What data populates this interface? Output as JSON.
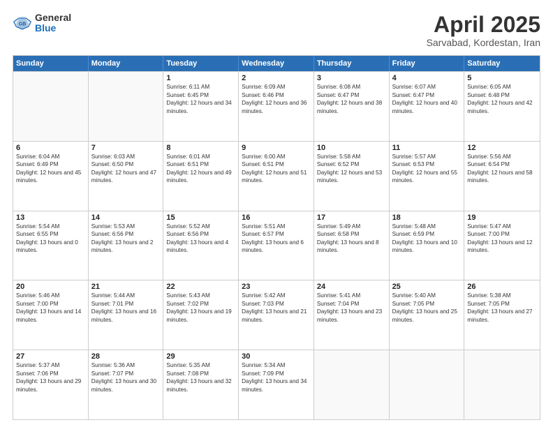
{
  "header": {
    "logo": {
      "general": "General",
      "blue": "Blue"
    },
    "title": "April 2025",
    "location": "Sarvabad, Kordestan, Iran"
  },
  "calendar": {
    "days": [
      "Sunday",
      "Monday",
      "Tuesday",
      "Wednesday",
      "Thursday",
      "Friday",
      "Saturday"
    ],
    "rows": [
      [
        {
          "day": "",
          "empty": true
        },
        {
          "day": "",
          "empty": true
        },
        {
          "day": "1",
          "sunrise": "Sunrise: 6:11 AM",
          "sunset": "Sunset: 6:45 PM",
          "daylight": "Daylight: 12 hours and 34 minutes."
        },
        {
          "day": "2",
          "sunrise": "Sunrise: 6:09 AM",
          "sunset": "Sunset: 6:46 PM",
          "daylight": "Daylight: 12 hours and 36 minutes."
        },
        {
          "day": "3",
          "sunrise": "Sunrise: 6:08 AM",
          "sunset": "Sunset: 6:47 PM",
          "daylight": "Daylight: 12 hours and 38 minutes."
        },
        {
          "day": "4",
          "sunrise": "Sunrise: 6:07 AM",
          "sunset": "Sunset: 6:47 PM",
          "daylight": "Daylight: 12 hours and 40 minutes."
        },
        {
          "day": "5",
          "sunrise": "Sunrise: 6:05 AM",
          "sunset": "Sunset: 6:48 PM",
          "daylight": "Daylight: 12 hours and 42 minutes."
        }
      ],
      [
        {
          "day": "6",
          "sunrise": "Sunrise: 6:04 AM",
          "sunset": "Sunset: 6:49 PM",
          "daylight": "Daylight: 12 hours and 45 minutes."
        },
        {
          "day": "7",
          "sunrise": "Sunrise: 6:03 AM",
          "sunset": "Sunset: 6:50 PM",
          "daylight": "Daylight: 12 hours and 47 minutes."
        },
        {
          "day": "8",
          "sunrise": "Sunrise: 6:01 AM",
          "sunset": "Sunset: 6:51 PM",
          "daylight": "Daylight: 12 hours and 49 minutes."
        },
        {
          "day": "9",
          "sunrise": "Sunrise: 6:00 AM",
          "sunset": "Sunset: 6:51 PM",
          "daylight": "Daylight: 12 hours and 51 minutes."
        },
        {
          "day": "10",
          "sunrise": "Sunrise: 5:58 AM",
          "sunset": "Sunset: 6:52 PM",
          "daylight": "Daylight: 12 hours and 53 minutes."
        },
        {
          "day": "11",
          "sunrise": "Sunrise: 5:57 AM",
          "sunset": "Sunset: 6:53 PM",
          "daylight": "Daylight: 12 hours and 55 minutes."
        },
        {
          "day": "12",
          "sunrise": "Sunrise: 5:56 AM",
          "sunset": "Sunset: 6:54 PM",
          "daylight": "Daylight: 12 hours and 58 minutes."
        }
      ],
      [
        {
          "day": "13",
          "sunrise": "Sunrise: 5:54 AM",
          "sunset": "Sunset: 6:55 PM",
          "daylight": "Daylight: 13 hours and 0 minutes."
        },
        {
          "day": "14",
          "sunrise": "Sunrise: 5:53 AM",
          "sunset": "Sunset: 6:56 PM",
          "daylight": "Daylight: 13 hours and 2 minutes."
        },
        {
          "day": "15",
          "sunrise": "Sunrise: 5:52 AM",
          "sunset": "Sunset: 6:56 PM",
          "daylight": "Daylight: 13 hours and 4 minutes."
        },
        {
          "day": "16",
          "sunrise": "Sunrise: 5:51 AM",
          "sunset": "Sunset: 6:57 PM",
          "daylight": "Daylight: 13 hours and 6 minutes."
        },
        {
          "day": "17",
          "sunrise": "Sunrise: 5:49 AM",
          "sunset": "Sunset: 6:58 PM",
          "daylight": "Daylight: 13 hours and 8 minutes."
        },
        {
          "day": "18",
          "sunrise": "Sunrise: 5:48 AM",
          "sunset": "Sunset: 6:59 PM",
          "daylight": "Daylight: 13 hours and 10 minutes."
        },
        {
          "day": "19",
          "sunrise": "Sunrise: 5:47 AM",
          "sunset": "Sunset: 7:00 PM",
          "daylight": "Daylight: 13 hours and 12 minutes."
        }
      ],
      [
        {
          "day": "20",
          "sunrise": "Sunrise: 5:46 AM",
          "sunset": "Sunset: 7:00 PM",
          "daylight": "Daylight: 13 hours and 14 minutes."
        },
        {
          "day": "21",
          "sunrise": "Sunrise: 5:44 AM",
          "sunset": "Sunset: 7:01 PM",
          "daylight": "Daylight: 13 hours and 16 minutes."
        },
        {
          "day": "22",
          "sunrise": "Sunrise: 5:43 AM",
          "sunset": "Sunset: 7:02 PM",
          "daylight": "Daylight: 13 hours and 19 minutes."
        },
        {
          "day": "23",
          "sunrise": "Sunrise: 5:42 AM",
          "sunset": "Sunset: 7:03 PM",
          "daylight": "Daylight: 13 hours and 21 minutes."
        },
        {
          "day": "24",
          "sunrise": "Sunrise: 5:41 AM",
          "sunset": "Sunset: 7:04 PM",
          "daylight": "Daylight: 13 hours and 23 minutes."
        },
        {
          "day": "25",
          "sunrise": "Sunrise: 5:40 AM",
          "sunset": "Sunset: 7:05 PM",
          "daylight": "Daylight: 13 hours and 25 minutes."
        },
        {
          "day": "26",
          "sunrise": "Sunrise: 5:38 AM",
          "sunset": "Sunset: 7:05 PM",
          "daylight": "Daylight: 13 hours and 27 minutes."
        }
      ],
      [
        {
          "day": "27",
          "sunrise": "Sunrise: 5:37 AM",
          "sunset": "Sunset: 7:06 PM",
          "daylight": "Daylight: 13 hours and 29 minutes."
        },
        {
          "day": "28",
          "sunrise": "Sunrise: 5:36 AM",
          "sunset": "Sunset: 7:07 PM",
          "daylight": "Daylight: 13 hours and 30 minutes."
        },
        {
          "day": "29",
          "sunrise": "Sunrise: 5:35 AM",
          "sunset": "Sunset: 7:08 PM",
          "daylight": "Daylight: 13 hours and 32 minutes."
        },
        {
          "day": "30",
          "sunrise": "Sunrise: 5:34 AM",
          "sunset": "Sunset: 7:09 PM",
          "daylight": "Daylight: 13 hours and 34 minutes."
        },
        {
          "day": "",
          "empty": true
        },
        {
          "day": "",
          "empty": true
        },
        {
          "day": "",
          "empty": true
        }
      ]
    ]
  }
}
